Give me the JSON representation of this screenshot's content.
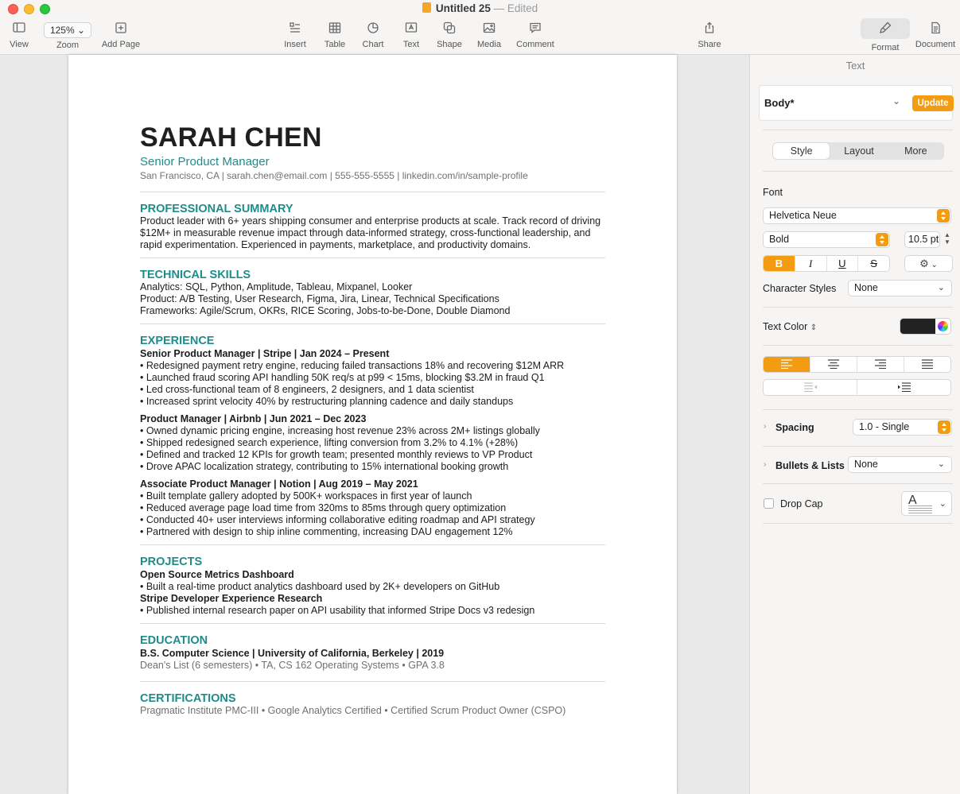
{
  "window": {
    "title": "Untitled 25",
    "separator": "—",
    "status": "Edited"
  },
  "toolbar": {
    "view": "View",
    "zoom_value": "125%",
    "zoom": "Zoom",
    "add_page": "Add Page",
    "insert": "Insert",
    "table": "Table",
    "chart": "Chart",
    "text": "Text",
    "shape": "Shape",
    "media": "Media",
    "comment": "Comment",
    "share": "Share",
    "format": "Format",
    "document": "Document"
  },
  "resume": {
    "name": "SARAH CHEN",
    "title": "Senior Product Manager",
    "contact": "San Francisco, CA  |  sarah.chen@email.com  |  555-555-5555  |  linkedin.com/in/sample-profile",
    "summary": {
      "heading": "PROFESSIONAL SUMMARY",
      "text": "Product leader with 6+ years shipping consumer and enterprise products at scale. Track record of driving $12M+ in measurable revenue impact through data-informed strategy, cross-functional leadership, and rapid experimentation. Experienced in payments, marketplace, and productivity domains."
    },
    "skills": {
      "heading": "TECHNICAL SKILLS",
      "lines": [
        "Analytics:  SQL, Python, Amplitude, Tableau, Mixpanel, Looker",
        "Product:  A/B Testing, User Research, Figma, Jira, Linear, Technical Specifications",
        "Frameworks:  Agile/Scrum, OKRs, RICE Scoring, Jobs-to-be-Done, Double Diamond"
      ]
    },
    "experience": {
      "heading": "EXPERIENCE",
      "jobs": [
        {
          "role": "Senior Product Manager  |  Stripe  |  Jan 2024 – Present",
          "bullets": [
            "•  Redesigned payment retry engine, reducing failed transactions 18% and recovering $12M ARR",
            "•  Launched fraud scoring API handling 50K req/s at p99 < 15ms, blocking $3.2M in fraud Q1",
            "•  Led cross-functional team of 8 engineers, 2 designers, and 1 data scientist",
            "•  Increased sprint velocity 40% by restructuring planning cadence and daily standups"
          ]
        },
        {
          "role": "Product Manager  |  Airbnb  |  Jun 2021 – Dec 2023",
          "bullets": [
            "•  Owned dynamic pricing engine, increasing host revenue 23% across 2M+ listings globally",
            "•  Shipped redesigned search experience, lifting conversion from 3.2% to 4.1% (+28%)",
            "•  Defined and tracked 12 KPIs for growth team; presented monthly reviews to VP Product",
            "•  Drove APAC localization strategy, contributing to 15% international booking growth"
          ]
        },
        {
          "role": "Associate Product Manager  |  Notion  |  Aug 2019 – May 2021",
          "bullets": [
            "•  Built template gallery adopted by 500K+ workspaces in first year of launch",
            "•  Reduced average page load time from 320ms to 85ms through query optimization",
            "•  Conducted 40+ user interviews informing collaborative editing roadmap and API strategy",
            "•  Partnered with design to ship inline commenting, increasing DAU engagement 12%"
          ]
        }
      ]
    },
    "projects": {
      "heading": "PROJECTS",
      "items": [
        {
          "title": "Open Source Metrics Dashboard",
          "bullet": "•  Built a real-time product analytics dashboard used by 2K+ developers on GitHub"
        },
        {
          "title": "Stripe Developer Experience Research",
          "bullet": "•  Published internal research paper on API usability that informed Stripe Docs v3 redesign"
        }
      ]
    },
    "education": {
      "heading": "EDUCATION",
      "degree": "B.S. Computer Science  |  University of California, Berkeley  |  2019",
      "details": "Dean's List (6 semesters)  •  TA, CS 162 Operating Systems  •  GPA 3.8"
    },
    "certifications": {
      "heading": "CERTIFICATIONS",
      "text": "Pragmatic Institute PMC-III  •  Google Analytics Certified  •  Certified Scrum Product Owner (CSPO)"
    }
  },
  "inspector": {
    "title": "Text",
    "paragraph_style": "Body*",
    "update": "Update",
    "tabs": [
      "Style",
      "Layout",
      "More"
    ],
    "font_label": "Font",
    "font_family": "Helvetica Neue",
    "font_weight": "Bold",
    "font_size": "10.5 pt",
    "bold": "B",
    "italic": "I",
    "underline": "U",
    "strike": "S",
    "char_styles_label": "Character Styles",
    "char_styles_value": "None",
    "text_color_label": "Text Color",
    "text_color": "#222222",
    "spacing_label": "Spacing",
    "spacing_value": "1.0 - Single",
    "bullets_label": "Bullets & Lists",
    "bullets_value": "None",
    "drop_cap_label": "Drop Cap",
    "accent": "#f39c12"
  }
}
